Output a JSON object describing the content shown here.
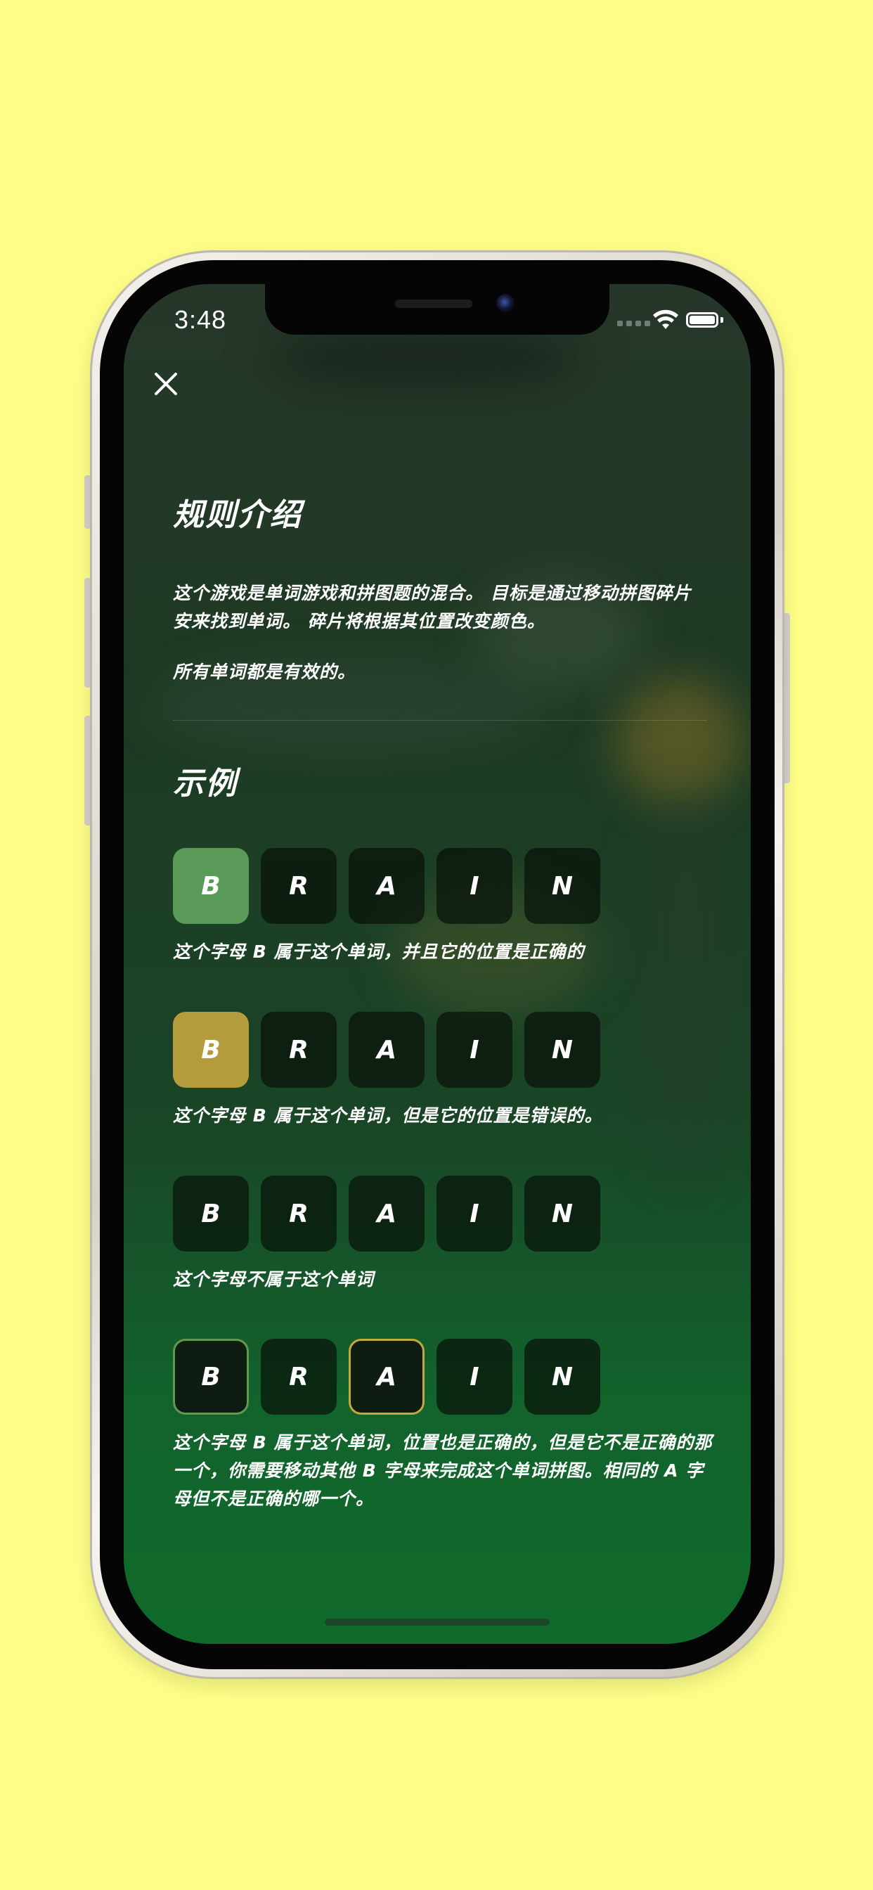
{
  "status_bar": {
    "time": "3:48"
  },
  "rules": {
    "title": "规则介绍",
    "intro": "这个游戏是单词游戏和拼图题的混合。 目标是通过移动拼图碎片安来找到单词。 碎片将根据其位置改变颜色。",
    "all_valid": "所有单词都是有效的。"
  },
  "examples": {
    "title": "示例",
    "items": [
      {
        "tiles": [
          {
            "letter": "B",
            "state": "correct"
          },
          {
            "letter": "R",
            "state": "dark"
          },
          {
            "letter": "A",
            "state": "dark"
          },
          {
            "letter": "I",
            "state": "dark"
          },
          {
            "letter": "N",
            "state": "dark"
          }
        ],
        "caption": "这个字母 B 属于这个单词，并且它的位置是正确的"
      },
      {
        "tiles": [
          {
            "letter": "B",
            "state": "present"
          },
          {
            "letter": "R",
            "state": "dark"
          },
          {
            "letter": "A",
            "state": "dark"
          },
          {
            "letter": "I",
            "state": "dark"
          },
          {
            "letter": "N",
            "state": "dark"
          }
        ],
        "caption": "这个字母 B 属于这个单词，但是它的位置是错误的。"
      },
      {
        "tiles": [
          {
            "letter": "B",
            "state": "dark"
          },
          {
            "letter": "R",
            "state": "dark"
          },
          {
            "letter": "A",
            "state": "dark"
          },
          {
            "letter": "I",
            "state": "dark"
          },
          {
            "letter": "N",
            "state": "dark"
          }
        ],
        "caption": "这个字母不属于这个单词"
      },
      {
        "tiles": [
          {
            "letter": "B",
            "state": "outline-green"
          },
          {
            "letter": "R",
            "state": "dark"
          },
          {
            "letter": "A",
            "state": "outline-yellow"
          },
          {
            "letter": "I",
            "state": "dark"
          },
          {
            "letter": "N",
            "state": "dark"
          }
        ],
        "caption": "这个字母 B 属于这个单词，位置也是正确的，但是它不是正确的那一个，你需要移动其他 B 字母来完成这个单词拼图。相同的 A 字母但不是正确的哪一个。"
      }
    ]
  },
  "colors": {
    "background": "#ffff88",
    "correct": "#5a9a58",
    "present": "#b49c3c",
    "dark_tile": "#0e1c11",
    "outline_green": "#5f9a50",
    "outline_yellow": "#c3a93d"
  },
  "icons": {
    "close": "close-icon",
    "wifi": "wifi-icon",
    "battery": "battery-icon"
  }
}
